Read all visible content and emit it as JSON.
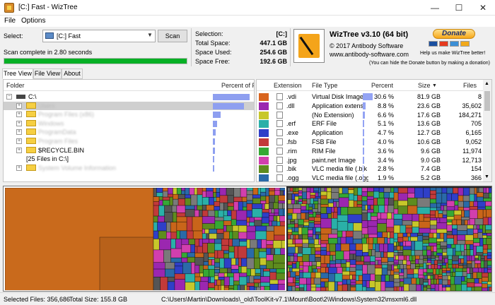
{
  "window": {
    "title": "[C:] Fast - WizTree"
  },
  "menu": [
    "File",
    "Options"
  ],
  "top": {
    "select_label": "Select:",
    "drive_value": "[C:] Fast",
    "scan_label": "Scan",
    "status": "Scan complete in 2.80 seconds",
    "progress_pct": 100
  },
  "stats": {
    "selection_label": "Selection:",
    "selection_value": "[C:]",
    "total_label": "Total Space:",
    "total_value": "447.1 GB",
    "used_label": "Space Used:",
    "used_value": "254.6 GB",
    "free_label": "Space Free:",
    "free_value": "192.6 GB"
  },
  "about": {
    "product": "WizTree v3.10 (64 bit)",
    "copyright": "© 2017 Antibody Software",
    "url": "www.antibody-software.com",
    "donate_label": "Donate",
    "donate_note": "Help us make WizTree better!",
    "donate_hint": "(You can hide the Donate button by making a donation)"
  },
  "tabs": [
    "Tree View",
    "File View",
    "About"
  ],
  "tree": {
    "col_folder": "Folder",
    "col_percent": "Percent of Pa",
    "rows": [
      {
        "label": "C:\\",
        "pct": 100,
        "blur": false,
        "expand": "−",
        "indent": 0,
        "icon": "drive"
      },
      {
        "label": "Users",
        "pct": 85,
        "blur": true,
        "expand": "+",
        "indent": 1,
        "icon": "folder",
        "selected": true
      },
      {
        "label": "Program Files (x86)",
        "pct": 22,
        "blur": true,
        "expand": "+",
        "indent": 1,
        "icon": "folder"
      },
      {
        "label": "Windows",
        "pct": 12,
        "blur": true,
        "expand": "+",
        "indent": 1,
        "icon": "folder"
      },
      {
        "label": "ProgramData",
        "pct": 7,
        "blur": true,
        "expand": "+",
        "indent": 1,
        "icon": "folder"
      },
      {
        "label": "Program Files",
        "pct": 6,
        "blur": true,
        "expand": "+",
        "indent": 1,
        "icon": "folder"
      },
      {
        "label": "$RECYCLE.BIN",
        "pct": 5,
        "blur": false,
        "expand": "+",
        "indent": 1,
        "icon": "folder"
      },
      {
        "label": "[25 Files in C:\\]",
        "pct": 4,
        "blur": false,
        "expand": "",
        "indent": 1,
        "icon": "none"
      },
      {
        "label": "System Volume Information",
        "pct": 3,
        "blur": true,
        "expand": "+",
        "indent": 1,
        "icon": "folder"
      }
    ]
  },
  "files": {
    "col_extension": "Extension",
    "col_filetype": "File Type",
    "col_percent": "Percent",
    "col_size": "Size",
    "col_files": "Files",
    "rows": [
      {
        "swatch": "#d8641e",
        "ext": ".vdi",
        "type": "Virtual Disk Image",
        "pct": "30.6 %",
        "pctv": 30.6,
        "size": "81.9 GB",
        "files": "8"
      },
      {
        "swatch": "#9b27b0",
        "ext": ".dll",
        "type": "Application extens",
        "pct": "8.8 %",
        "pctv": 8.8,
        "size": "23.6 GB",
        "files": "35,602"
      },
      {
        "swatch": "#c7c72a",
        "ext": "",
        "type": "(No Extension)",
        "pct": "6.6 %",
        "pctv": 6.6,
        "size": "17.6 GB",
        "files": "184,271"
      },
      {
        "swatch": "#2ab0a8",
        "ext": ".erf",
        "type": "ERF File",
        "pct": "5.1 %",
        "pctv": 5.1,
        "size": "13.6 GB",
        "files": "705"
      },
      {
        "swatch": "#2f3fc8",
        "ext": ".exe",
        "type": "Application",
        "pct": "4.7 %",
        "pctv": 4.7,
        "size": "12.7 GB",
        "files": "6,165"
      },
      {
        "swatch": "#c23a3a",
        "ext": ".fsb",
        "type": "FSB File",
        "pct": "4.0 %",
        "pctv": 4.0,
        "size": "10.6 GB",
        "files": "9,052"
      },
      {
        "swatch": "#35a835",
        "ext": ".rim",
        "type": "RIM File",
        "pct": "3.6 %",
        "pctv": 3.6,
        "size": "9.6 GB",
        "files": "11,974"
      },
      {
        "swatch": "#d23fae",
        "ext": ".jpg",
        "type": "paint.net Image",
        "pct": "3.4 %",
        "pctv": 3.4,
        "size": "9.0 GB",
        "files": "12,713"
      },
      {
        "swatch": "#5e8c1e",
        "ext": ".bik",
        "type": "VLC media file (.bik",
        "pct": "2.8 %",
        "pctv": 2.8,
        "size": "7.4 GB",
        "files": "154"
      },
      {
        "swatch": "#2a6aa8",
        "ext": ".ogg",
        "type": "VLC media file (.ogg",
        "pct": "1.9 %",
        "pctv": 1.9,
        "size": "5.2 GB",
        "files": "366"
      }
    ]
  },
  "status": {
    "selected_files": "Selected Files: 356,686",
    "total_size": "Total Size: 155.8 GB",
    "path": "C:\\Users\\Martin\\Downloads\\_old\\ToolKit-v7.1\\Mount\\Boot\\2\\Windows\\System32\\msxml6.dll"
  },
  "treemap_colors": [
    "#c9651a",
    "#9b27b0",
    "#c7c72a",
    "#2ab0a8",
    "#2f3fc8",
    "#c23a3a",
    "#35a835",
    "#d23fae",
    "#5e8c1e",
    "#2a6aa8",
    "#555555",
    "#7a7a7a"
  ]
}
